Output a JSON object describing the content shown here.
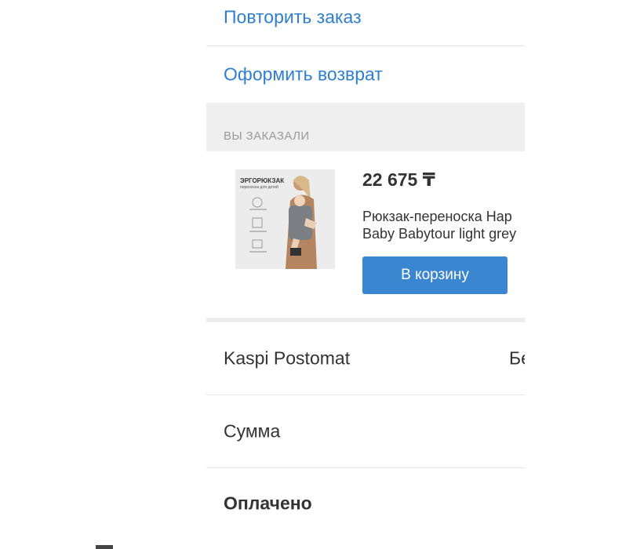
{
  "actions": {
    "repeat_order": "Повторить заказ",
    "return_order": "Оформить возврат"
  },
  "section": {
    "title": "ВЫ ЗАКАЗАЛИ"
  },
  "product": {
    "image_title": "ЭРГОРЮКЗАК",
    "image_subtitle": "переноска для детей",
    "price": "22 675 ₸",
    "name_line1": "Рюкзак-переноска Hap",
    "name_line2": "Baby Babytour light grey",
    "add_to_cart": "В корзину"
  },
  "summary": {
    "delivery_label": "Kaspi Postomat",
    "delivery_value": "Бе",
    "sum_label": "Сумма",
    "paid_label": "Оплачено"
  },
  "colors": {
    "link": "#2f7fd0",
    "button": "#3b86d1",
    "section_bg": "#efefef"
  }
}
